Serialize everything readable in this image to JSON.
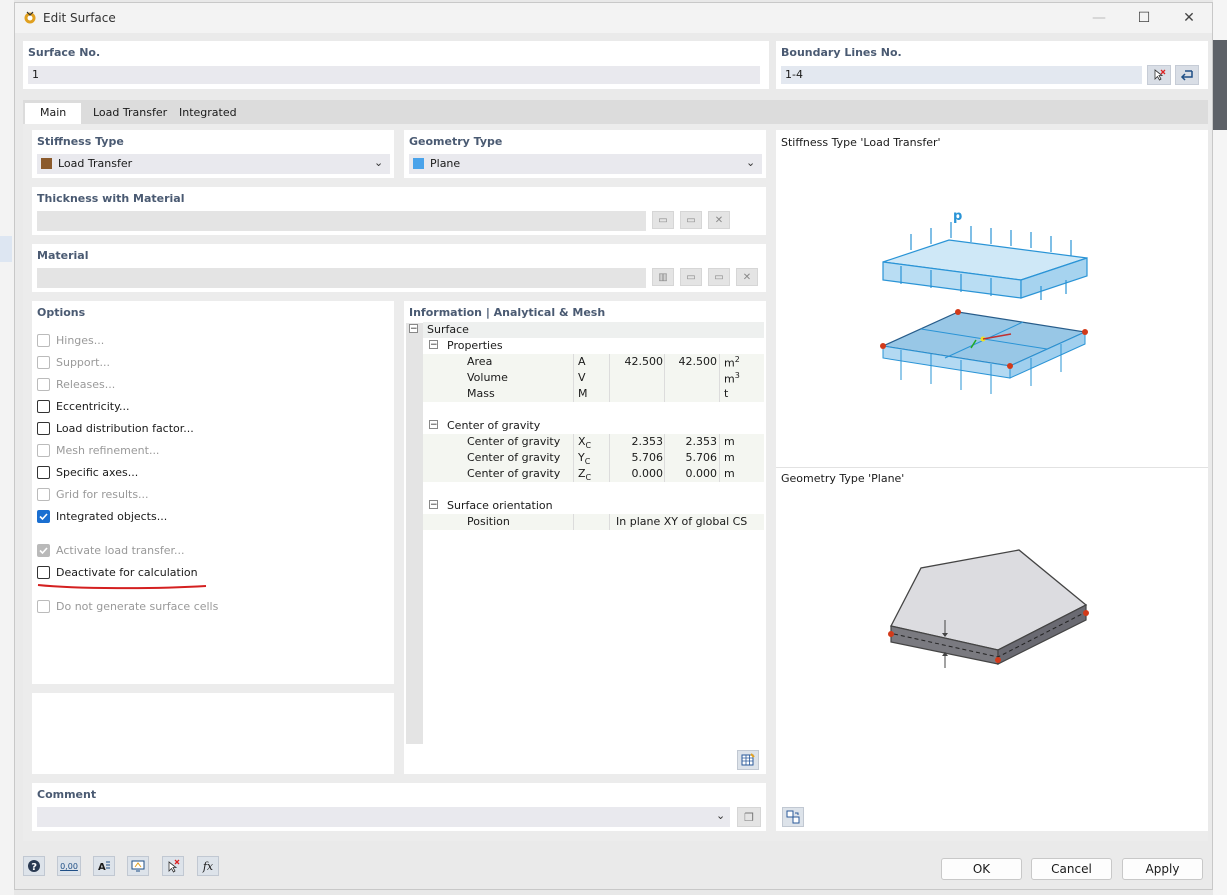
{
  "window": {
    "title": "Edit Surface"
  },
  "surface_no": {
    "label": "Surface No.",
    "value": "1"
  },
  "boundary": {
    "label": "Boundary Lines No.",
    "value": "1-4"
  },
  "tabs": [
    {
      "label": "Main"
    },
    {
      "label": "Load Transfer"
    },
    {
      "label": "Integrated"
    }
  ],
  "stiffness": {
    "label": "Stiffness Type",
    "value": "Load Transfer",
    "color": "#8b5a2b"
  },
  "geometry": {
    "label": "Geometry Type",
    "value": "Plane",
    "color": "#4aa3ea"
  },
  "thickness": {
    "label": "Thickness with Material"
  },
  "material": {
    "label": "Material"
  },
  "options": {
    "label": "Options",
    "items": [
      {
        "label": "Hinges...",
        "state": "disabled"
      },
      {
        "label": "Support...",
        "state": "disabled"
      },
      {
        "label": "Releases...",
        "state": "disabled"
      },
      {
        "label": "Eccentricity...",
        "state": "enabled"
      },
      {
        "label": "Load distribution factor...",
        "state": "enabled"
      },
      {
        "label": "Mesh refinement...",
        "state": "disabled"
      },
      {
        "label": "Specific axes...",
        "state": "enabled"
      },
      {
        "label": "Grid for results...",
        "state": "disabled"
      },
      {
        "label": "Integrated objects...",
        "state": "checked"
      },
      {
        "label": "Activate load transfer...",
        "state": "checked-disabled"
      },
      {
        "label": "Deactivate for calculation",
        "state": "enabled"
      },
      {
        "label": "Do not generate surface cells",
        "state": "disabled"
      }
    ]
  },
  "info": {
    "label": "Information | Analytical & Mesh",
    "root": "Surface",
    "properties": {
      "label": "Properties",
      "rows": [
        {
          "name": "Area",
          "sym": "A",
          "v1": "42.500",
          "v2": "42.500",
          "unit": "m",
          "sup": "2"
        },
        {
          "name": "Volume",
          "sym": "V",
          "v1": "",
          "v2": "",
          "unit": "m",
          "sup": "3"
        },
        {
          "name": "Mass",
          "sym": "M",
          "v1": "",
          "v2": "",
          "unit": "t",
          "sup": ""
        }
      ]
    },
    "cog": {
      "label": "Center of gravity",
      "rows": [
        {
          "name": "Center of gravity",
          "sym": "X",
          "sub": "C",
          "v1": "2.353",
          "v2": "2.353",
          "unit": "m"
        },
        {
          "name": "Center of gravity",
          "sym": "Y",
          "sub": "C",
          "v1": "5.706",
          "v2": "5.706",
          "unit": "m"
        },
        {
          "name": "Center of gravity",
          "sym": "Z",
          "sub": "C",
          "v1": "0.000",
          "v2": "0.000",
          "unit": "m"
        }
      ]
    },
    "orientation": {
      "label": "Surface orientation",
      "rows": [
        {
          "name": "Position",
          "value": "In plane XY of global CS"
        }
      ]
    }
  },
  "preview": {
    "stiffness_title": "Stiffness Type 'Load Transfer'",
    "load_symbol": "p",
    "geometry_title": "Geometry Type 'Plane'"
  },
  "comment": {
    "label": "Comment",
    "value": ""
  },
  "buttons": {
    "ok": "OK",
    "cancel": "Cancel",
    "apply": "Apply"
  },
  "toolbar": {
    "numeric_label": "0,00",
    "fx_label": "fx"
  }
}
